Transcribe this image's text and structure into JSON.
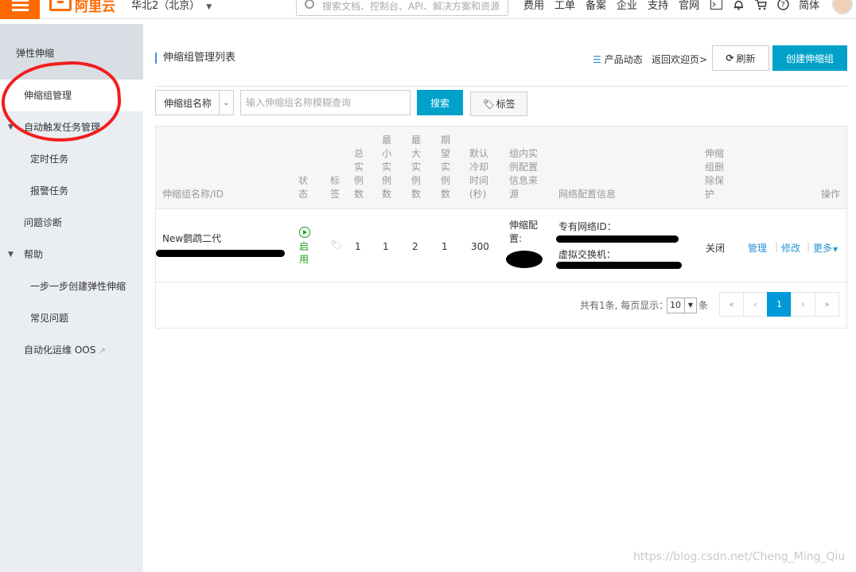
{
  "topbar": {
    "logo_text": "阿里云",
    "region": "华北2（北京）",
    "search_placeholder": "搜索文档、控制台、API、解决方案和资源",
    "nav": [
      "费用",
      "工单",
      "备案",
      "企业",
      "支持",
      "官网"
    ],
    "icons": [
      "terminal-icon",
      "bell-icon",
      "cart-icon",
      "help-icon"
    ],
    "language": "简体"
  },
  "sidebar": {
    "header": "弹性伸缩",
    "items": [
      {
        "label": "伸缩组管理",
        "active": true
      },
      {
        "label": "自动触发任务管理",
        "expandable": true
      },
      {
        "label": "定时任务",
        "sub": true
      },
      {
        "label": "报警任务",
        "sub": true
      },
      {
        "label": "问题诊断"
      },
      {
        "label": "帮助",
        "expandable": true
      },
      {
        "label": "一步一步创建弹性伸缩",
        "sub": true
      },
      {
        "label": "常见问题",
        "sub": true
      },
      {
        "label": "自动化运维 OOS",
        "external": true
      }
    ]
  },
  "main": {
    "title": "伸缩组管理列表",
    "product_news": "产品动态",
    "back_link": "返回欢迎页>",
    "refresh_label": "刷新",
    "create_label": "创建伸缩组",
    "filter_select": "伸缩组名称",
    "filter_placeholder": "输入伸缩组名称模糊查询",
    "search_label": "搜索",
    "tag_label": "标签"
  },
  "table": {
    "headers": {
      "name": "伸缩组名称/ID",
      "status": "状态",
      "tag": "标签",
      "total": "总实例数",
      "min": "最小实例数",
      "max": "最大实例数",
      "desired": "期望实例数",
      "cooldown": "默认冷却时间(秒)",
      "config_source": "组内实例配置信息来源",
      "network": "网络配置信息",
      "protection": "伸缩组删除保护",
      "actions": "操作"
    },
    "rows": [
      {
        "name": "New鹦鹉二代",
        "status": "启用",
        "total": "1",
        "min": "1",
        "max": "2",
        "desired": "1",
        "cooldown": "300",
        "config_source": "伸缩配置:",
        "vpc_label": "专有网络ID：",
        "vswitch_label": "虚拟交换机：",
        "protection": "关闭",
        "action_manage": "管理",
        "action_edit": "修改",
        "action_more": "更多"
      }
    ]
  },
  "pagination": {
    "summary": "共有1条, 每页显示：",
    "page_size": "10",
    "suffix": "条",
    "buttons": [
      "«",
      "‹",
      "1",
      "›",
      "»"
    ],
    "current": "1"
  },
  "watermark": "https://blog.csdn.net/Cheng_Ming_Qiu",
  "colors": {
    "brand": "#ff6a00",
    "primary": "#00a2ca",
    "link": "#2b8fd6",
    "enabled": "#1a9c1a",
    "annotation": "#f21e1e"
  }
}
